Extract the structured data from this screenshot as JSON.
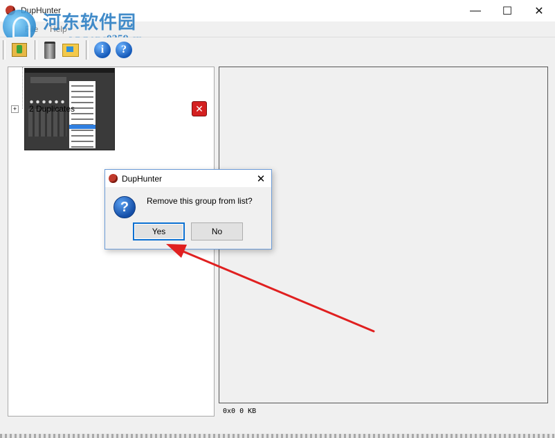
{
  "window": {
    "title": "DupHunter"
  },
  "watermark": {
    "brand": "河东软件园",
    "url": "www.pc0359.cn"
  },
  "menubar": {
    "items": [
      "File",
      "Help"
    ]
  },
  "toolbar": {
    "buttons": [
      {
        "name": "open-icon"
      },
      {
        "name": "trash-icon"
      },
      {
        "name": "folder-icon"
      },
      {
        "name": "info-icon",
        "glyph": "i"
      },
      {
        "name": "help-icon",
        "glyph": "?"
      }
    ]
  },
  "tree": {
    "toggle": "+",
    "group_label": "2 Duplicates",
    "delete_glyph": "✕"
  },
  "status": {
    "text": "0x0 0 KB"
  },
  "dialog": {
    "title": "DupHunter",
    "message": "Remove this group from list?",
    "icon_glyph": "?",
    "yes_label": "Yes",
    "no_label": "No",
    "close_glyph": "✕"
  },
  "annotation": {
    "arrow_color": "#e02020"
  },
  "window_controls": {
    "minimize": "—",
    "maximize": "☐",
    "close": "✕"
  }
}
